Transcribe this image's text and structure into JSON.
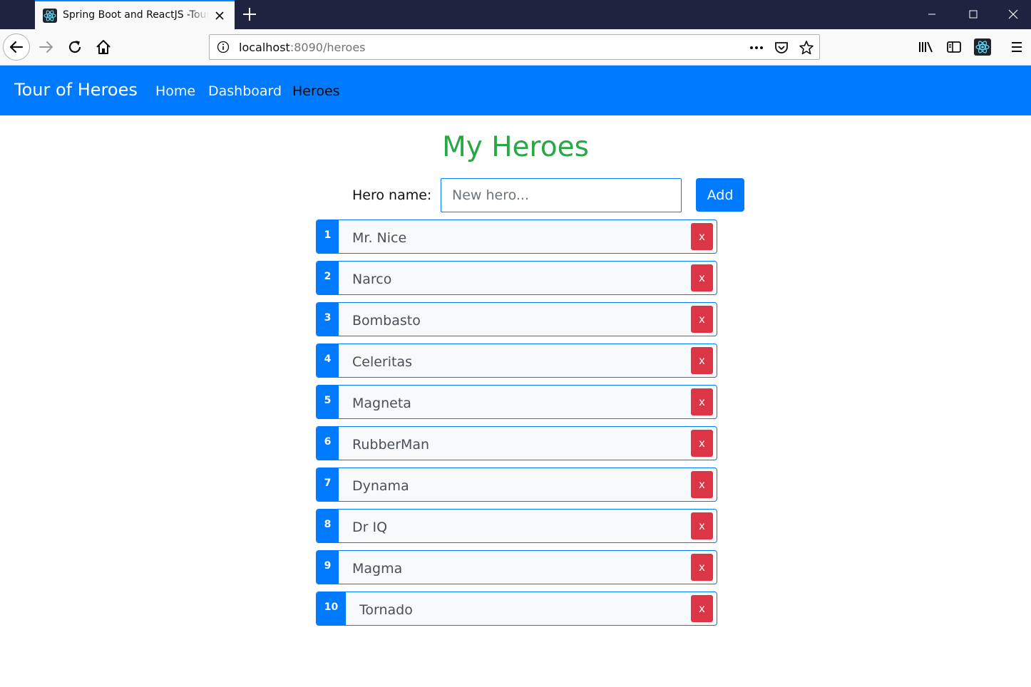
{
  "browser": {
    "tab_title": "Spring Boot and ReactJS -Tour of Heroes",
    "url_host": "localhost",
    "url_rest": ":8090/heroes"
  },
  "app": {
    "brand": "Tour of Heroes",
    "nav": [
      {
        "label": "Home",
        "active": false
      },
      {
        "label": "Dashboard",
        "active": false
      },
      {
        "label": "Heroes",
        "active": true
      }
    ]
  },
  "page": {
    "title": "My Heroes",
    "form": {
      "label": "Hero name:",
      "placeholder": "New hero...",
      "value": "",
      "add_label": "Add"
    },
    "delete_label": "x",
    "heroes": [
      {
        "id": "1",
        "name": "Mr. Nice"
      },
      {
        "id": "2",
        "name": "Narco"
      },
      {
        "id": "3",
        "name": "Bombasto"
      },
      {
        "id": "4",
        "name": "Celeritas"
      },
      {
        "id": "5",
        "name": "Magneta"
      },
      {
        "id": "6",
        "name": "RubberMan"
      },
      {
        "id": "7",
        "name": "Dynama"
      },
      {
        "id": "8",
        "name": "Dr IQ"
      },
      {
        "id": "9",
        "name": "Magma"
      },
      {
        "id": "10",
        "name": "Tornado"
      }
    ]
  },
  "colors": {
    "primary": "#007bff",
    "success": "#28a745",
    "danger": "#dc3545"
  }
}
